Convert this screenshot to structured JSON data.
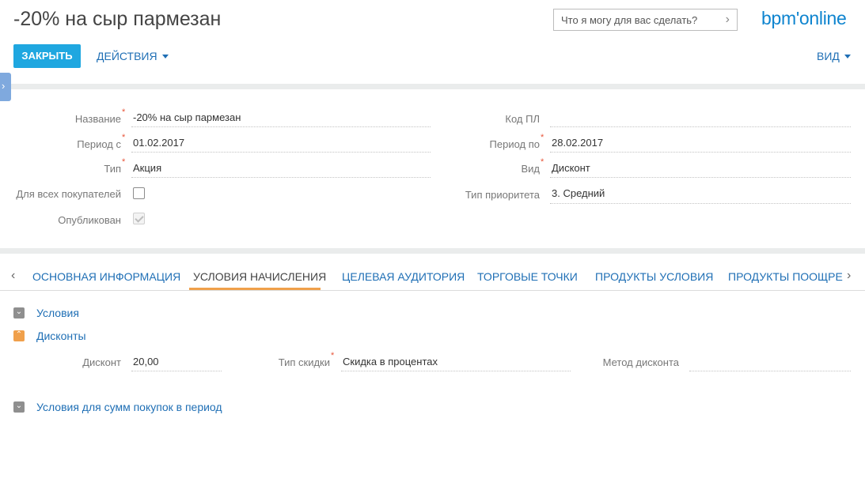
{
  "header": {
    "title": "-20% на сыр пармезан",
    "search_placeholder": "Что я могу для вас сделать?",
    "logo": "bpm'online"
  },
  "toolbar": {
    "close_label": "ЗАКРЫТЬ",
    "actions_label": "ДЕЙСТВИЯ",
    "view_label": "ВИД"
  },
  "form": {
    "name_label": "Название",
    "name_value": "-20% на сыр пармезан",
    "period_from_label": "Период с",
    "period_from_value": "01.02.2017",
    "type_label": "Тип",
    "type_value": "Акция",
    "all_customers_label": "Для всех покупателей",
    "published_label": "Опубликован",
    "code_label": "Код ПЛ",
    "code_value": "",
    "period_to_label": "Период по",
    "period_to_value": "28.02.2017",
    "kind_label": "Вид",
    "kind_value": "Дисконт",
    "priority_label": "Тип приоритета",
    "priority_value": "3. Средний",
    "all_customers_checked": false,
    "published_checked": true
  },
  "tabs": [
    {
      "label": "ОСНОВНАЯ ИНФОРМАЦИЯ"
    },
    {
      "label": "УСЛОВИЯ НАЧИСЛЕНИЯ"
    },
    {
      "label": "ЦЕЛЕВАЯ АУДИТОРИЯ"
    },
    {
      "label": "ТОРГОВЫЕ ТОЧКИ"
    },
    {
      "label": "ПРОДУКТЫ УСЛОВИЯ"
    },
    {
      "label": "ПРОДУКТЫ ПООЩРЕНИЯ"
    }
  ],
  "groups": {
    "conditions": "Условия",
    "discounts": "Дисконты",
    "purchase_sums": "Условия для сумм покупок в период"
  },
  "discount": {
    "discount_label": "Дисконт",
    "discount_value": "20,00",
    "discount_type_label": "Тип скидки",
    "discount_type_value": "Скидка в процентах",
    "method_label": "Метод дисконта",
    "method_value": ""
  }
}
